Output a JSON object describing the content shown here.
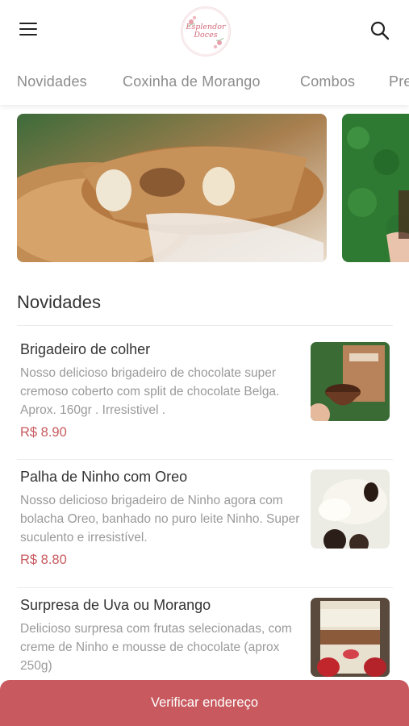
{
  "header": {
    "logo_text": "Esplendor Doces",
    "menu_icon": "hamburger-menu-icon",
    "search_icon": "search-icon"
  },
  "tabs": [
    {
      "label": "Novidades"
    },
    {
      "label": "Coxinha de Morango"
    },
    {
      "label": "Combos"
    },
    {
      "label": "Pre"
    }
  ],
  "section": {
    "title": "Novidades"
  },
  "products": [
    {
      "name": "Brigadeiro de colher",
      "description": "Nosso delicioso brigadeiro de chocolate super cremoso coberto com split de chocolate Belga. Aprox. 160gr . Irresistivel .",
      "price": "R$ 8.90"
    },
    {
      "name": "Palha de Ninho com Oreo",
      "description": "Nosso delicioso brigadeiro de Ninho agora com bolacha Oreo, banhado no puro leite Ninho. Super suculento e irresistível.",
      "price": "R$ 8.80"
    },
    {
      "name": "Surpresa de Uva ou Morango",
      "description": "Delicioso surpresa com frutas selecionadas, com creme de Ninho e mousse de chocolate (aprox 250g)",
      "price": ""
    }
  ],
  "cta": {
    "label": "Verificar endereço"
  },
  "colors": {
    "accent": "#c85a5f",
    "price": "#c85a5f",
    "muted_text": "#9a9a9a"
  }
}
